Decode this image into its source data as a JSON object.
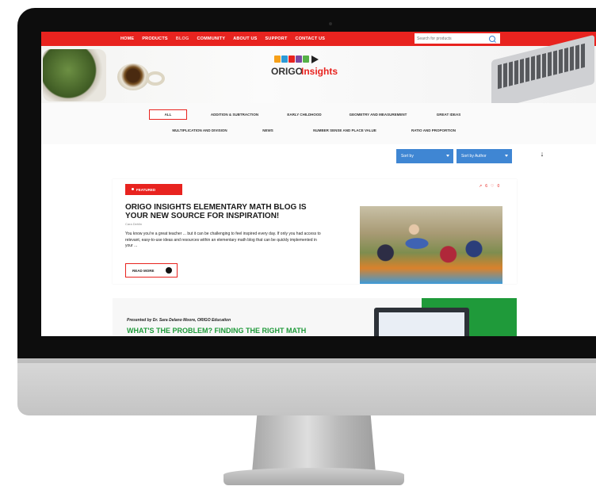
{
  "nav": {
    "items": [
      "HOME",
      "PRODUCTS",
      "BLOG",
      "COMMUNITY",
      "ABOUT US",
      "SUPPORT",
      "CONTACT US"
    ],
    "active": "BLOG"
  },
  "search": {
    "placeholder": "Search for products"
  },
  "logo": {
    "origo": "ORIGO",
    "insights": "Insights"
  },
  "filters": {
    "row1": [
      "ALL",
      "ADDITION & SUBTRACTION",
      "EARLY CHILDHOOD",
      "GEOMETRY AND MEASUREMENT",
      "GREAT IDEAS"
    ],
    "row2": [
      "MULTIPLICATION AND DIVISION",
      "NEWS",
      "NUMBER SENSE AND PLACE VALUE",
      "RATIO AND PROPORTION"
    ]
  },
  "sort": {
    "sort_by": "Sort by",
    "sort_by_author": "Sort by Author"
  },
  "featured": {
    "badge": "FEATURED",
    "likes": "6",
    "comments": "0",
    "title": "ORIGO INSIGHTS ELEMENTARY MATH BLOG IS YOUR NEW SOURCE FOR INSPIRATION!",
    "author": "Cara Dehlin",
    "excerpt": "You know you're a great teacher ... but it can be challenging to feel inspired every day. If only you had access to relevant, easy-to-use ideas and resources within an elementary math blog that can be quickly implemented in your ...",
    "read_more": "READ MORE"
  },
  "second": {
    "presented": "Presented by Dr. Sara Delano Moore, ORIGO Education",
    "title": "WHAT'S THE PROBLEM? FINDING THE RIGHT MATH"
  },
  "colors": {
    "brand_red": "#e8231f",
    "sort_blue": "#3f86d3",
    "accent_green": "#1f9a3a"
  }
}
